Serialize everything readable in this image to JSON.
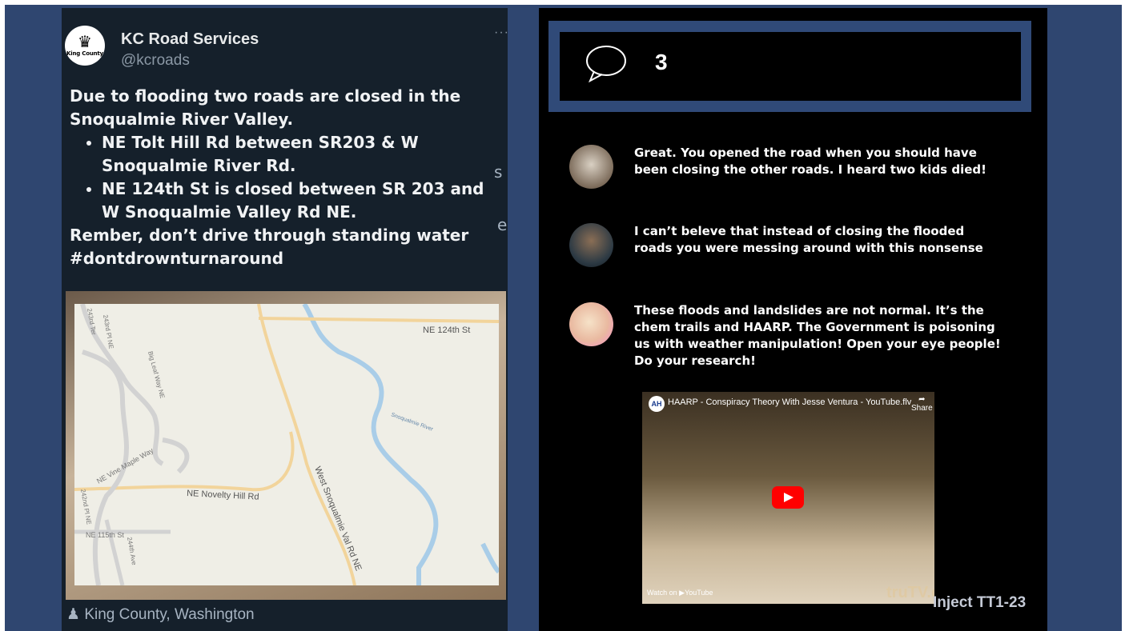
{
  "tweet": {
    "account_name": "KC Road Services",
    "handle": "@kcroads",
    "avatar_label": "King County",
    "intro": "Due to flooding two roads are closed in the Snoqualmie River Valley.",
    "bullets": [
      "NE Tolt Hill Rd between SR203 & W Snoqualmie River Rd.",
      "NE 124th St is closed between SR 203 and W Snoqualmie Valley Rd NE."
    ],
    "closing": "Rember, don’t drive through standing water #dontdrownturnaround",
    "stray_chars": [
      "s",
      "e"
    ],
    "location": "King County, Washington",
    "map_labels": {
      "ne124": "NE 124th St",
      "river": "Snoqualmie River",
      "novelty": "NE Novelty Hill Rd",
      "westsnoq": "West Snoqualmie Val Rd NE",
      "vinemaple": "NE Vine Maple Way",
      "bigleaf": "Big Leaf Way NE",
      "ne115": "NE 115th St",
      "ter243": "243rd Ter",
      "pl243": "243rd Pl NE",
      "pl242": "242nd Pl NE",
      "ave244": "244th Ave"
    }
  },
  "comments_header": {
    "count": "3"
  },
  "comments": [
    {
      "text": "Great. You opened the road when you should have been closing the other roads. I heard two kids died!"
    },
    {
      "text": "I can’t beleve that instead of closing the flooded roads you were messing around with this nonsense"
    },
    {
      "text": "These floods and landslides are not normal. It’s the chem trails and HAARP. The Government is poisoning us with weather manipulation! Open your eye people! Do your research!"
    }
  ],
  "video": {
    "title": "HAARP - Conspiracy Theory With Jesse Ventura - YouTube.flv",
    "share": "Share",
    "watch_on": "Watch on ▶YouTube",
    "watermark": "truTV.com"
  },
  "inject_label": "Inject TT1-23",
  "colors": {
    "background": "#2f4670",
    "tweet_bg": "#15202b",
    "comment_panel": "#000000",
    "accent_border": "#304a78"
  }
}
